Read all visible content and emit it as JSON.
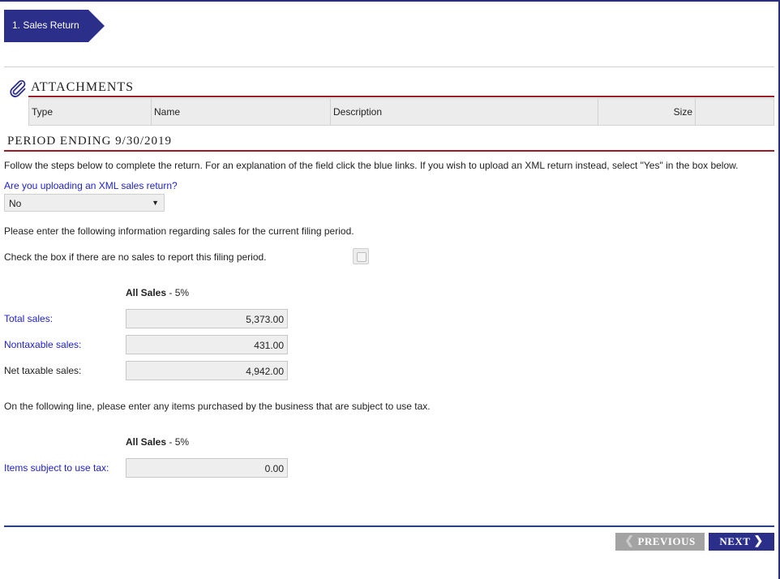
{
  "step": {
    "label": "1. Sales Return"
  },
  "attachments": {
    "title": "ATTACHMENTS",
    "columns": [
      "Type",
      "Name",
      "Description",
      "Size",
      ""
    ]
  },
  "period": {
    "title": "PERIOD ENDING 9/30/2019"
  },
  "instructions": "Follow the steps below to complete the return. For an explanation of the field click the blue links. If you wish to upload an XML return instead, select \"Yes\" in the box below.",
  "xml_question": {
    "label": "Are you uploading an XML sales return?",
    "value": "No"
  },
  "sales_info_text": "Please enter the following information regarding sales for the current filing period.",
  "no_sales": {
    "label": "Check the box if there are no sales to report this filing period.",
    "checked": false
  },
  "sales_section": {
    "heading": "All Sales",
    "rate": " - 5%",
    "rows": [
      {
        "label": "Total sales:",
        "value": "5,373.00",
        "link": true
      },
      {
        "label": "Nontaxable sales:",
        "value": "431.00",
        "link": true
      },
      {
        "label": "Net taxable sales:",
        "value": "4,942.00",
        "link": false
      }
    ]
  },
  "use_tax_text": "On the following line, please enter any items purchased by the business that are subject to use tax.",
  "use_tax_section": {
    "heading": "All Sales",
    "rate": " - 5%",
    "row": {
      "label": "Items subject to use tax:",
      "value": "0.00"
    }
  },
  "nav": {
    "previous": "PREVIOUS",
    "next": "NEXT"
  },
  "colors": {
    "brand_navy": "#2b2f8a",
    "accent_red": "#9b1c24",
    "link_blue": "#1d1fc9"
  }
}
